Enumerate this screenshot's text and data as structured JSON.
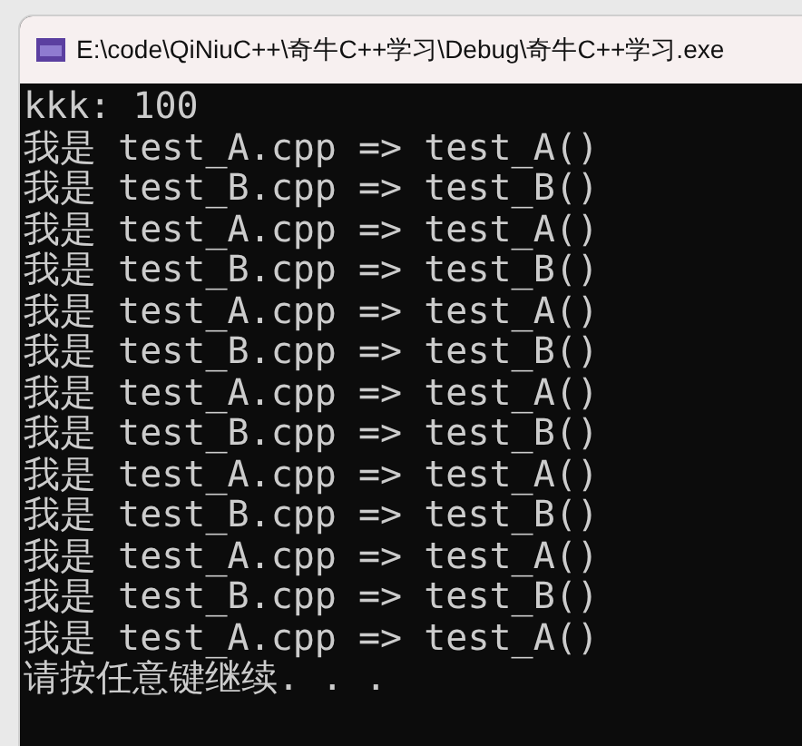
{
  "window": {
    "title": "E:\\code\\QiNiuC++\\奇牛C++学习\\Debug\\奇牛C++学习.exe"
  },
  "console": {
    "lines": [
      "kkk: 100",
      "我是 test_A.cpp => test_A()",
      "我是 test_B.cpp => test_B()",
      "我是 test_A.cpp => test_A()",
      "我是 test_B.cpp => test_B()",
      "我是 test_A.cpp => test_A()",
      "我是 test_B.cpp => test_B()",
      "我是 test_A.cpp => test_A()",
      "我是 test_B.cpp => test_B()",
      "我是 test_A.cpp => test_A()",
      "我是 test_B.cpp => test_B()",
      "我是 test_A.cpp => test_A()",
      "我是 test_B.cpp => test_B()",
      "我是 test_A.cpp => test_A()",
      "请按任意键继续. . ."
    ]
  }
}
